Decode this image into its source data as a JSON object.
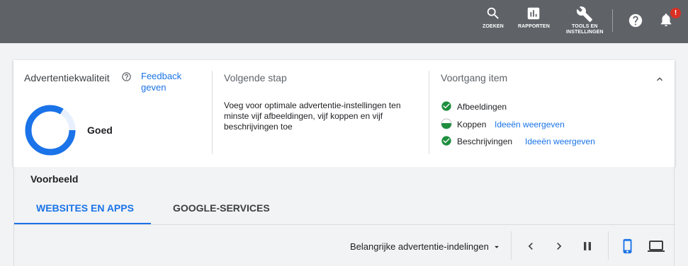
{
  "topbar": {
    "search_label": "ZOEKEN",
    "reports_label": "RAPPORTEN",
    "tools_label_line1": "TOOLS EN",
    "tools_label_line2": "INSTELLINGEN",
    "notification_badge": "!"
  },
  "quality": {
    "title": "Advertentiekwaliteit",
    "feedback_line1": "Feedback",
    "feedback_line2": "geven",
    "rating": "Goed"
  },
  "next_step": {
    "title": "Volgende stap",
    "line1": "Voeg voor optimale advertentie-instellingen ten",
    "line2": "minste vijf afbeeldingen, vijf koppen en vijf",
    "line3": "beschrijvingen toe"
  },
  "progress": {
    "title": "Voortgang item",
    "items": [
      {
        "label": "Afbeeldingen",
        "link": ""
      },
      {
        "label": "Koppen",
        "link": "Ideeën weergeven"
      },
      {
        "label": "Beschrijvingen",
        "link": "Ideeën weergeven"
      }
    ]
  },
  "preview": {
    "title": "Voorbeeld",
    "tabs": [
      "WEBSITES EN APPS",
      "GOOGLE-SERVICES"
    ],
    "format_select": "Belangrijke advertentie-indelingen"
  },
  "colors": {
    "accent": "#1a73e8",
    "success": "#1e8e3e",
    "topbar": "#5f6368"
  }
}
